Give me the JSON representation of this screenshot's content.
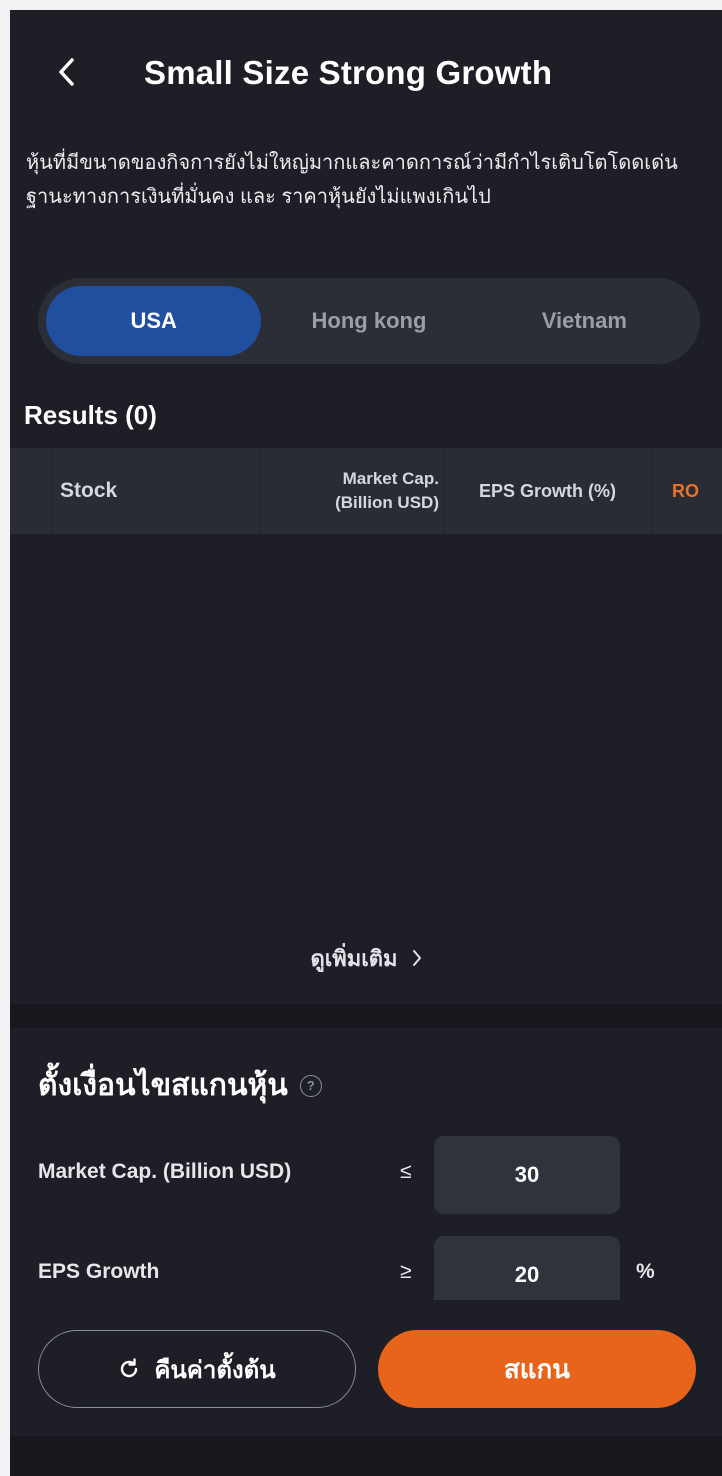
{
  "header": {
    "back_icon": "chevron-left-icon",
    "title": "Small Size Strong Growth"
  },
  "description": "หุ้นที่มีขนาดของกิจการยังไม่ใหญ่มากและคาดการณ์ว่ามีกำไรเติบโตโดดเด่น ฐานะทางการเงินที่มั่นคง และ ราคาหุ้นยังไม่แพงเกินไป",
  "markets": {
    "tabs": [
      {
        "label": "USA",
        "active": true
      },
      {
        "label": "Hong kong",
        "active": false
      },
      {
        "label": "Vietnam",
        "active": false
      }
    ]
  },
  "results": {
    "title": "Results (0)",
    "columns": {
      "stock": "Stock",
      "market_cap": "Market Cap.",
      "market_cap_unit": "(Billion USD)",
      "eps_growth": "EPS Growth (%)",
      "extra": "RO"
    },
    "rows": [],
    "see_more": "ดูเพิ่มเติม",
    "see_more_icon": "chevron-right-icon"
  },
  "conditions": {
    "title": "ตั้งเงื่อนไขสแกนหุ้น",
    "help_icon": "help-circle-icon",
    "market_cap": {
      "label": "Market Cap. (Billion USD)",
      "operator": "≤",
      "value": "30",
      "unit": ""
    },
    "eps_growth": {
      "label": "EPS Growth",
      "operator": "≥",
      "value": "20",
      "unit": "%"
    }
  },
  "actions": {
    "reset_label": "คืนค่าตั้งต้น",
    "reset_icon": "refresh-icon",
    "scan_label": "สแกน"
  },
  "colors": {
    "background": "#1e1f26",
    "accent_orange": "#e8641b",
    "active_tab_blue": "#1f4f9e"
  }
}
